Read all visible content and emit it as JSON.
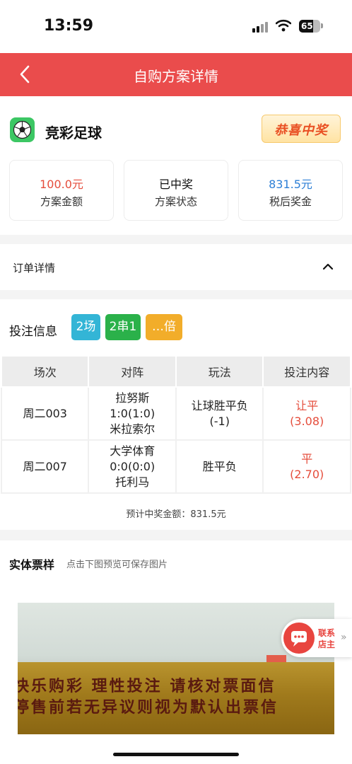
{
  "status_bar": {
    "time": "13:59",
    "battery": "65",
    "battery_level": 0.65
  },
  "nav": {
    "title": "自购方案详情",
    "back_icon": "chevron-left-icon"
  },
  "summary": {
    "brand": "竞彩足球",
    "brand_icon": "football-icon",
    "win_badge": "恭喜中奖",
    "stats": [
      {
        "value": "100.0元",
        "label": "方案金额",
        "color": "#e54d3c"
      },
      {
        "value": "已中奖",
        "label": "方案状态",
        "color": "#111111"
      },
      {
        "value": "831.5元",
        "label": "税后奖金",
        "color": "#2d7fd6"
      }
    ]
  },
  "order": {
    "title": "订单详情",
    "toggle_icon": "chevron-up-icon"
  },
  "bet": {
    "label": "投注信息",
    "chips": [
      {
        "text": "2场",
        "color": "#33b5d6"
      },
      {
        "text": "2串1",
        "color": "#2bb14a"
      },
      {
        "text": "…倍",
        "color": "#f2ad2a"
      }
    ],
    "columns": [
      "场次",
      "对阵",
      "玩法",
      "投注内容"
    ],
    "rows": [
      {
        "match_no": "周二003",
        "home": "拉努斯",
        "score": "1:0(1:0)",
        "away": "米拉索尔",
        "play": "让球胜平负",
        "play_sub": "(-1)",
        "pick": "让平",
        "odds": "(3.08)"
      },
      {
        "match_no": "周二007",
        "home": "大学体育",
        "score": "0:0(0:0)",
        "away": "托利马",
        "play": "胜平负",
        "play_sub": "",
        "pick": "平",
        "odds": "(2.70)"
      }
    ],
    "total": "预计中奖金额：831.5元"
  },
  "ticket": {
    "title": "实体票样",
    "hint": "点击下图预览可保存图片",
    "photo_line1": "快乐购彩  理性投注  请核对票面信",
    "photo_line2": "停售前若无异议则视为默认出票信"
  },
  "contact": {
    "line1": "联系",
    "line2": "店主",
    "icon": "chat-icon",
    "more_icon": "double-chevron-right-icon"
  }
}
